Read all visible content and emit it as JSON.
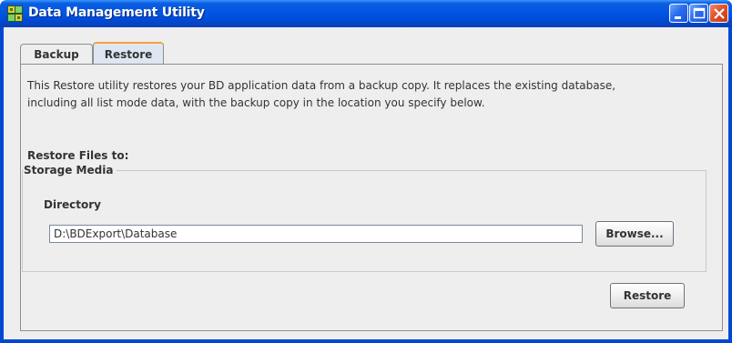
{
  "window": {
    "title": "Data Management Utility",
    "icons": {
      "app": "app-icon",
      "minimize": "minimize-icon",
      "maximize": "maximize-icon",
      "close": "close-icon"
    },
    "colors": {
      "titlebar": "#0054e3",
      "tab_accent": "#f6a23a",
      "close_button": "#e0522a"
    }
  },
  "tabs": [
    {
      "label": "Backup",
      "selected": false
    },
    {
      "label": "Restore",
      "selected": true
    }
  ],
  "restore": {
    "description": "This Restore utility restores your BD application data from a backup copy. It replaces the existing database, including all list mode data, with the backup copy in the location you specify below.",
    "restore_files_to_label": "Restore Files to:",
    "group_title": "Storage Media",
    "directory_label": "Directory",
    "directory_value": "D:\\BDExport\\Database",
    "browse_label": "Browse...",
    "restore_label": "Restore"
  }
}
